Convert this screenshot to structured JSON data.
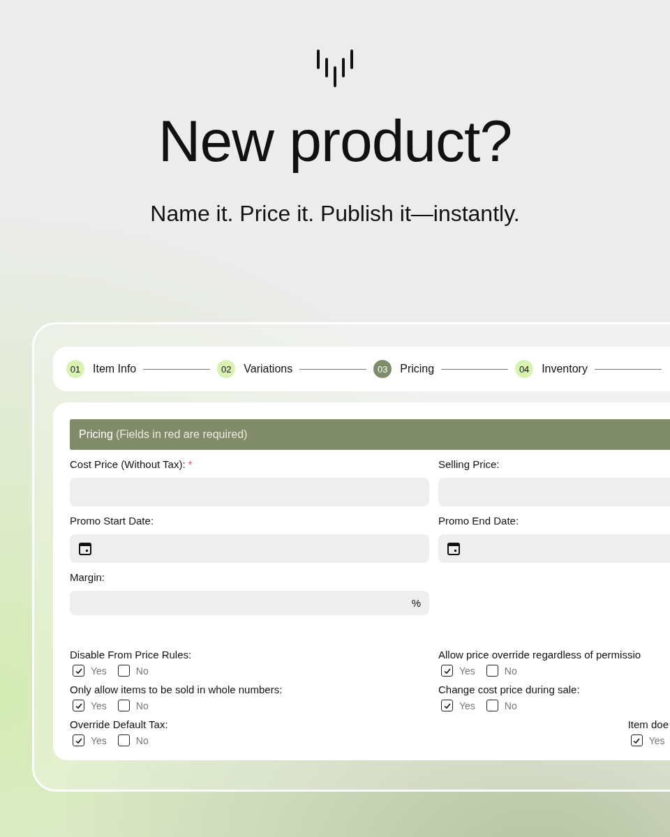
{
  "hero": {
    "title": "New product?",
    "subtitle": "Name it. Price it. Publish it—instantly."
  },
  "steps": [
    {
      "number": "01",
      "label": "Item Info",
      "selected": false
    },
    {
      "number": "02",
      "label": "Variations",
      "selected": false
    },
    {
      "number": "03",
      "label": "Pricing",
      "selected": true
    },
    {
      "number": "04",
      "label": "Inventory",
      "selected": false
    }
  ],
  "section": {
    "title": "Pricing",
    "note": "(Fields in red are required)"
  },
  "fields": [
    {
      "label": "Cost Price (Without Tax):",
      "required": true,
      "kind": "text"
    },
    {
      "label": "Selling Price:",
      "required": false,
      "kind": "text"
    },
    {
      "label": "Promo Start Date:",
      "required": false,
      "kind": "date"
    },
    {
      "label": "Promo End Date:",
      "required": false,
      "kind": "date"
    },
    {
      "label": "Margin:",
      "required": false,
      "kind": "percent",
      "suffix": "%"
    }
  ],
  "required_mark": "*",
  "option_rows": [
    {
      "items": [
        {
          "label": "Disable From Price Rules:",
          "choices": [
            {
              "label": "Yes",
              "checked": true
            },
            {
              "label": "No",
              "checked": false
            }
          ]
        },
        {
          "label": "Allow price override regardless of permissio",
          "choices": [
            {
              "label": "Yes",
              "checked": true
            },
            {
              "label": "No",
              "checked": false
            }
          ]
        }
      ]
    },
    {
      "items": [
        {
          "label": "Only allow items to be sold in whole numbers:",
          "choices": [
            {
              "label": "Yes",
              "checked": true
            },
            {
              "label": "No",
              "checked": false
            }
          ]
        },
        {
          "label": "Change cost price during sale:",
          "choices": [
            {
              "label": "Yes",
              "checked": true
            },
            {
              "label": "No",
              "checked": false
            }
          ]
        }
      ]
    },
    {
      "items": [
        {
          "label": "Override Default Tax:",
          "choices": [
            {
              "label": "Yes",
              "checked": true
            },
            {
              "label": "No",
              "checked": false
            }
          ]
        },
        {
          "label": "Item doe",
          "trailing": true,
          "choices": [
            {
              "label": "Yes",
              "checked": true
            }
          ]
        }
      ]
    }
  ]
}
